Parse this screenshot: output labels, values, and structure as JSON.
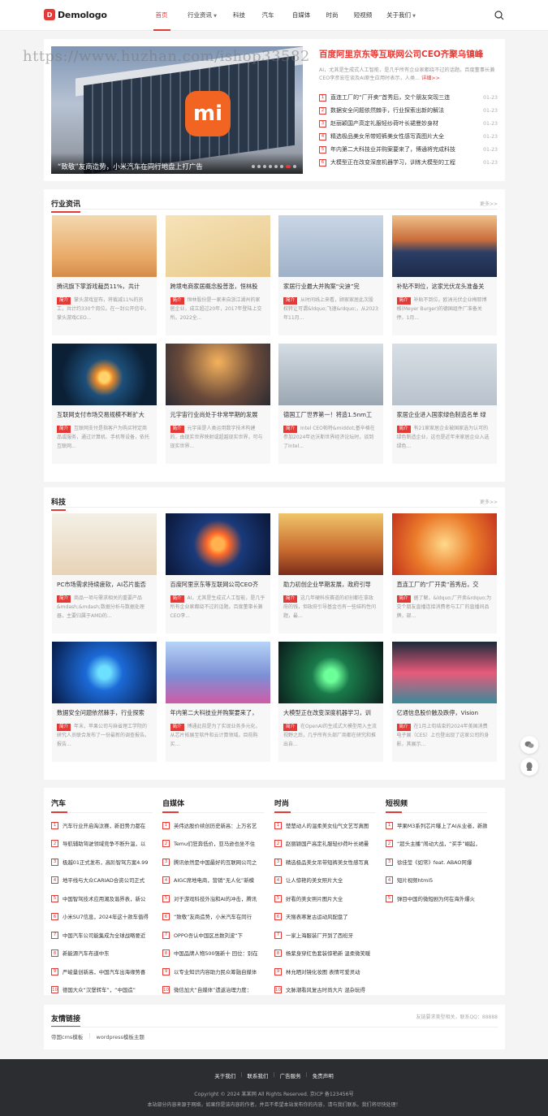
{
  "header": {
    "logo": "Demologo",
    "logo_mark": "D",
    "nav": [
      {
        "label": "首页",
        "active": true,
        "dropdown": false
      },
      {
        "label": "行业资讯",
        "active": false,
        "dropdown": true
      },
      {
        "label": "科技",
        "active": false,
        "dropdown": false
      },
      {
        "label": "汽车",
        "active": false,
        "dropdown": false
      },
      {
        "label": "自媒体",
        "active": false,
        "dropdown": false
      },
      {
        "label": "时尚",
        "active": false,
        "dropdown": false
      },
      {
        "label": "短视频",
        "active": false,
        "dropdown": false
      },
      {
        "label": "关于我们",
        "active": false,
        "dropdown": true
      }
    ],
    "search_icon": "search-icon"
  },
  "watermark": "https://www.huzhan.com/ishop33582",
  "hero": {
    "slide_caption": "“致敬”友商造势，小米汽车在同行地盘上打广告",
    "slide_logo": "mi",
    "dots": 8,
    "active_dot": 6,
    "top_title": "百度阿里京东等互联网公司CEO齐聚乌镇峰",
    "top_desc": "AI，尤其是生成式人工智能，是几乎所有企业家都绕不过的话题。百度董事长兼CEO李彦宏在谈及AI原生应用时表示，人类...",
    "top_more": "详细>>",
    "list": [
      {
        "title": "直连工厂的“厂开卖”首秀后，交个朋友突现三连",
        "date": "01-23"
      },
      {
        "title": "数据安全问题依然棘手，行业探索出新的解法",
        "date": "01-23"
      },
      {
        "title": "赵丽颖国产高定礼服轻纱荷叶长裙曼妙身材",
        "date": "01-23"
      },
      {
        "title": "精选极品美女吊带短裤美女性感写真图片大全",
        "date": "01-23"
      },
      {
        "title": "年内第二大科技业并购案要来了，博通将完成科技",
        "date": "01-23"
      },
      {
        "title": "大模型正在改变深度机器学习，训练大模型的工程",
        "date": "01-23"
      }
    ]
  },
  "section_more": "更多>>",
  "tag_label": "简介",
  "industry": {
    "title": "行业资讯",
    "cards": [
      {
        "title": "腾讯旗下掌游戏裁员11%，共计",
        "desc": "掌头游戏宣布，将裁减11%的员工，共计约330个岗位。在一封公开信中，掌头游戏CEO..."
      },
      {
        "title": "跨境电商家居概念股普涨，恒林股",
        "desc": "恒林股份是一家来自浙江湖州的家居企业，成立超过20年，2017年登陆上交所。2022全..."
      },
      {
        "title": "家居行业最大并购案“尖迪”完",
        "desc": "从时间线上来看，顾家家居此次股权转让可谓&ldquo;飞速&rdquo;，从2023年11月..."
      },
      {
        "title": "补贴不到位，这家光伏龙头准备关",
        "desc": "补贴不到位，欧洲光伏企业梅耶博格(Meyer Burger)的德国组件厂准备关停，1月..."
      },
      {
        "title": "互联网支付市场交易规模不断扩大",
        "desc": "互联网支付是指客户为购买特定商品或服务，通过计算机、手机等设备，依托互联网..."
      },
      {
        "title": "元宇宙行业尚处于非常早期的发展",
        "desc": "元宇宙是人类运用数字技术构建的，由现实世界映射或超越现实世界，可与现实世界..."
      },
      {
        "title": "德国工厂世界第一！将造1.5nm工",
        "desc": "Intel CEO帕特&middot;基辛格在参加2024年达沃斯世界经济论坛时，谈到了Intel..."
      },
      {
        "title": "家居企业进入国家绿色制造名单 绿",
        "desc": "有21家家居企业被国家选为认可的绿色制造企业，这也是近年来家居企业入选绿色..."
      }
    ]
  },
  "tech": {
    "title": "科技",
    "cards": [
      {
        "title": "PC市场需求持续疲软，AI芯片能否",
        "desc": "商品一项与需求相关的重要产品&mdash;&mdash;数据分析与数据处理器，主要归属于AMD的..."
      },
      {
        "title": "百度阿里京东等互联网公司CEO齐",
        "desc": "AI，尤其是生成式人工智能，是几乎所有企业家都绕不过的话题。百度董事长兼CEO李..."
      },
      {
        "title": "助力初创企业早期发展，政府引导",
        "desc": "这几年硬科技赛道的初创都在拿政府的钱，但政府引导基金也有一些结构性问题，最..."
      },
      {
        "title": "直连工厂的“厂开卖”首秀后，交",
        "desc": "据了解，&ldquo;厂开卖&rdquo;为交个朋友直播连接消费者与工厂的直播间品牌，部..."
      },
      {
        "title": "数据安全问题依然棘手，行业探索",
        "desc": "年末，苹果公司与麻省理工学院的研究人员联合发布了一份最新的调查报告。报告..."
      },
      {
        "title": "年内第二大科技业并购案要来了，",
        "desc": "博通此前是为了实现业务多元化，从芯片拓展至软件和云计算领域。目前购买..."
      },
      {
        "title": "大模型正在改变深度机器学习，训",
        "desc": "在OpenAI的生成式大模型用入主流视野之后，几乎所有头部厂商都在研究和推出自..."
      },
      {
        "title": "亿通信息股价触及跌停，Vision",
        "desc": "在1月上旬结束的2024年美国消费电子展（CES）上也登出现了这家公司的身影，其展示..."
      }
    ]
  },
  "columns": [
    {
      "title": "汽车",
      "items": [
        "汽车行业开启淘汰赛，新旧势力都在",
        "导航辅助驾驶领域竞争不断升温，以",
        "极越01正式发布，高阶智驾方案4.99",
        "地平线与大众CARIAD合资公司正式",
        "中国智驾技术应用潮及谐界表，新公",
        "小米SU7信息，2024年这十款车值得",
        "中国汽车公司能集成为全球战略要近",
        "新能源汽车布道中东",
        "严峻量创新高，中国汽车出海缘势喜",
        "德国大众“汉堡转车”，“中国造”"
      ]
    },
    {
      "title": "自媒体",
      "items": [
        "英伟达股价续创历史新高：上万名艺",
        "Temu们狂奔低价，亚马逊也坐不住",
        "腾讯依然是中国最好的互联网公司之",
        "AIGC席地电商，营销“无人化”新模",
        "对于游戏科技外溢和AI的冲击，腾讯",
        "“致敬”友商造势，小米汽车在同行",
        "OPPO吾认中国区总数刘波“下",
        "中国品牌人物500强新十 回位：别在",
        "以专业知识内容助力民众筹融自媒体",
        "微信加大“自媒体”遗返治理力度："
      ]
    },
    {
      "title": "时尚",
      "items": [
        "楚楚动人的温柔美女仙气文艺写真图",
        "赵丽颖国产高定礼服轻纱荷叶长裙曼",
        "精选极品美女吊带短裤美女性感写真",
        "让人惊艳的美女照片大全",
        "好看的美女照片图片大全",
        "天猴表寒复古运动风配盘了",
        "一家上海服装厂开到了西班牙",
        "杨紫身穿红色套装惊艳新 温柔微笑暖",
        "林允晒对镜化妆图 表情可爱灵动",
        "文脉潮看风复古时尚大片 混杂玩得"
      ]
    },
    {
      "title": "短视频",
      "items": [
        "苹果M3系列芯片曝上了AI从业者，新款",
        "“超头主播”闹动大战，“买手”崛起，",
        "徐佳莹《如常》feat. ABAO阿爆",
        "短片视频html5",
        "弹目中国的微短剧为何在海外爆火"
      ]
    }
  ],
  "links": {
    "title": "友情链接",
    "note": "友链要求美型相关，联系QQ：88888",
    "items": [
      "帝国cms模板",
      "wordpress模板主题"
    ]
  },
  "footer": {
    "links": [
      "关于我们",
      "联系我们",
      "广告服务",
      "免责声明"
    ],
    "copyright": "Copyright © 2024 某某网 All Rights Reserved. 京ICP 备123456号",
    "notice": "本站部分内容来源于网络，如果你是该内容的作者，并且不希望本站发布你的内容，请与我们联系。我们将尽快处理！"
  },
  "floats": [
    "wechat-icon",
    "qq-icon"
  ]
}
